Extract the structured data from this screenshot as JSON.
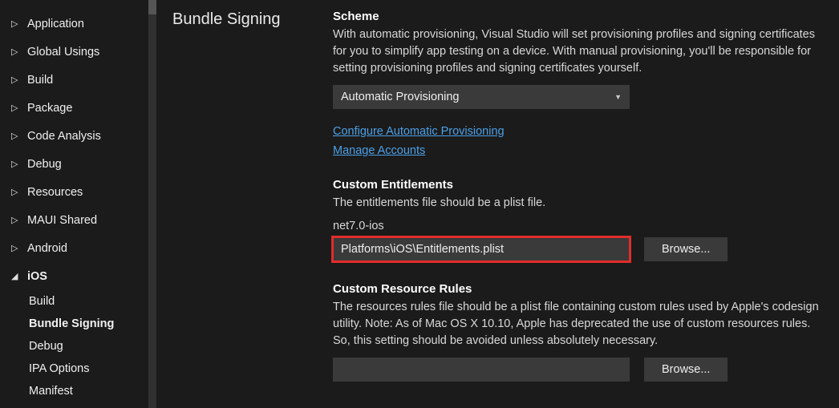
{
  "sidebar": {
    "items": [
      {
        "label": "Application",
        "expanded": false,
        "sub": false
      },
      {
        "label": "Global Usings",
        "expanded": false,
        "sub": false
      },
      {
        "label": "Build",
        "expanded": false,
        "sub": false
      },
      {
        "label": "Package",
        "expanded": false,
        "sub": false
      },
      {
        "label": "Code Analysis",
        "expanded": false,
        "sub": false
      },
      {
        "label": "Debug",
        "expanded": false,
        "sub": false
      },
      {
        "label": "Resources",
        "expanded": false,
        "sub": false
      },
      {
        "label": "MAUI Shared",
        "expanded": false,
        "sub": false
      },
      {
        "label": "Android",
        "expanded": false,
        "sub": false
      },
      {
        "label": "iOS",
        "expanded": true,
        "sub": false,
        "bold": true
      }
    ],
    "subitems": [
      {
        "label": "Build"
      },
      {
        "label": "Bundle Signing",
        "bold": true
      },
      {
        "label": "Debug"
      },
      {
        "label": "IPA Options"
      },
      {
        "label": "Manifest"
      }
    ]
  },
  "section": {
    "title": "Bundle Signing"
  },
  "scheme": {
    "heading": "Scheme",
    "desc": "With automatic provisioning, Visual Studio will set provisioning profiles and signing certificates for you to simplify app testing on a device. With manual provisioning, you'll be responsible for setting provisioning profiles and signing certificates yourself.",
    "selected": "Automatic Provisioning",
    "link1": "Configure Automatic Provisioning",
    "link2": "Manage Accounts"
  },
  "entitlements": {
    "heading": "Custom Entitlements",
    "desc": "The entitlements file should be a plist file.",
    "target": "net7.0-ios",
    "path": "Platforms\\iOS\\Entitlements.plist",
    "browse": "Browse..."
  },
  "resourceRules": {
    "heading": "Custom Resource Rules",
    "desc": "The resources rules file should be a plist file containing custom rules used by Apple's codesign utility. Note: As of Mac OS X 10.10, Apple has deprecated the use of custom resources rules. So, this setting should be avoided unless absolutely necessary.",
    "path": "",
    "browse": "Browse..."
  }
}
